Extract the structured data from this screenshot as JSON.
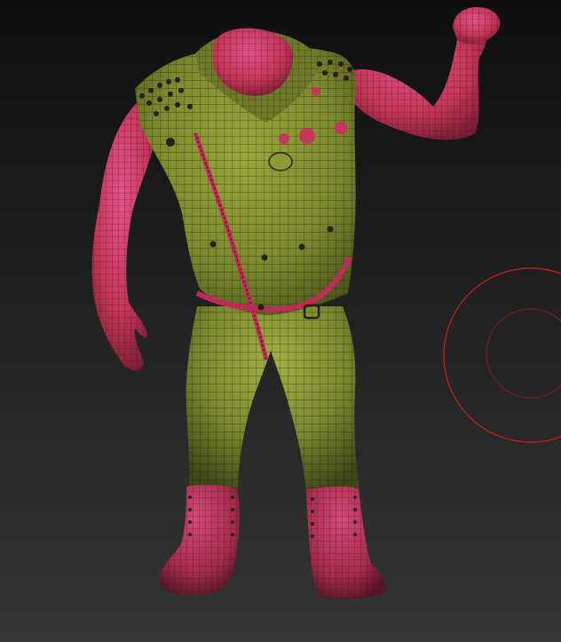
{
  "viewport": {
    "background_top": "#0f0f0f",
    "background_bottom": "#343434"
  },
  "model": {
    "skin_color": "#c7355a",
    "skin_highlight": "#e0528a",
    "clothing_color": "#7c8a2e",
    "clothing_highlight": "#9aa83c",
    "wire_color": "#1a1208",
    "stud_color": "#2a1e10"
  },
  "brush_cursor": {
    "outer_color": "#d21f1f",
    "inner_color": "#8a1a1a"
  }
}
